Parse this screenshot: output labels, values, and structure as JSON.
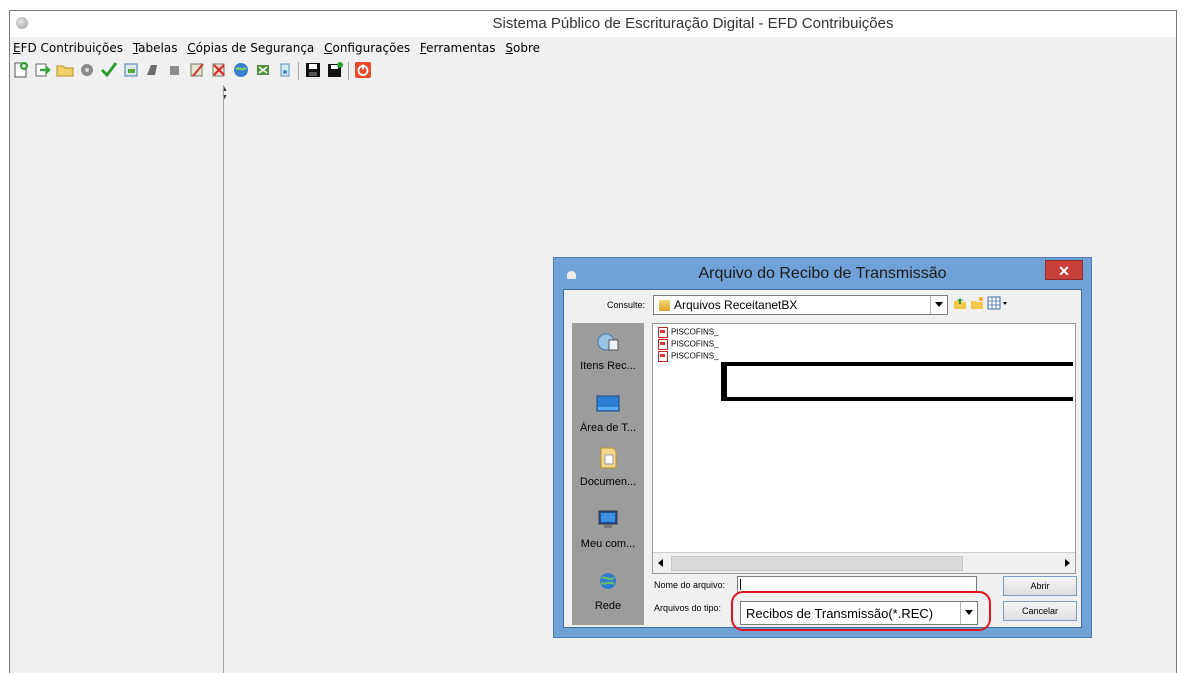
{
  "window": {
    "title": "Sistema Público de Escrituração Digital - EFD Contribuições"
  },
  "menu": [
    "EFD Contribuições",
    "Tabelas",
    "Cópias de Segurança",
    "Configurações",
    "Ferramentas",
    "Sobre"
  ],
  "toolbar": {
    "icons": [
      "new-icon",
      "import-icon",
      "open-folder-icon",
      "validate-icon",
      "check-icon",
      "print-icon",
      "sign-icon",
      "stop-icon",
      "edit-icon",
      "delete-icon",
      "transmit-icon",
      "report-icon",
      "search-icon",
      "save-icon",
      "save-as-icon",
      "exit-icon"
    ]
  },
  "dialog": {
    "title": "Arquivo do Recibo de Transmissão",
    "close_label": "✕",
    "look_in_label": "Consulte:",
    "look_in_value": "Arquivos ReceitanetBX",
    "places": [
      {
        "label": "Itens Rec...",
        "icon": "recent-items-icon"
      },
      {
        "label": "Área de T...",
        "icon": "desktop-icon"
      },
      {
        "label": "Documen...",
        "icon": "documents-icon"
      },
      {
        "label": "Meu com...",
        "icon": "computer-icon"
      },
      {
        "label": "Rede",
        "icon": "network-icon"
      }
    ],
    "files": [
      "PISCOFINS_",
      "PISCOFINS_",
      "PISCOFINS_"
    ],
    "file_name_label": "Nome do arquivo:",
    "file_name_value": "",
    "file_type_label": "Arquivos do tipo:",
    "file_type_value": "Recibos de Transmissão(*.REC)",
    "open_button": "Abrir",
    "cancel_button": "Cancelar"
  },
  "colors": {
    "dialog_frame": "#6fa3d8",
    "close_button": "#c7413a",
    "highlight": "#e0141e"
  }
}
